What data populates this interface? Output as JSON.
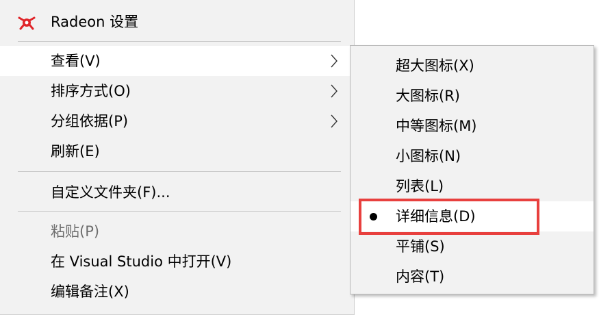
{
  "main_menu": {
    "radeon": "Radeon 设置",
    "view": "查看(V)",
    "sort": "排序方式(O)",
    "group": "分组依据(P)",
    "refresh": "刷新(E)",
    "customize": "自定义文件夹(F)...",
    "paste": "粘贴(P)",
    "open_vs": "在 Visual Studio 中打开(V)",
    "edit_notes": "编辑备注(X)"
  },
  "view_submenu": {
    "extra_large": "超大图标(X)",
    "large": "大图标(R)",
    "medium": "中等图标(M)",
    "small": "小图标(N)",
    "list": "列表(L)",
    "details": "详细信息(D)",
    "tiles": "平铺(S)",
    "content": "内容(T)"
  },
  "colors": {
    "menu_bg": "#f2f2f2",
    "hover_bg": "#ffffff",
    "highlight_border": "#e8403e",
    "radeon_red": "#e0252a"
  },
  "icons": {
    "radeon": "radeon-logo-icon",
    "submenu_arrow": "chevron-right-icon",
    "selected": "radio-bullet-icon"
  }
}
